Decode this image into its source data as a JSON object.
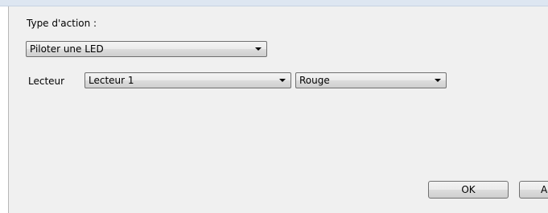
{
  "action_type": {
    "label": "Type d'action :",
    "selected": "Piloter une LED"
  },
  "reader": {
    "label": "Lecteur",
    "selected": "Lecteur 1"
  },
  "color": {
    "selected": "Rouge"
  },
  "buttons": {
    "ok": "OK",
    "cancel_partial": "Ar"
  },
  "icons": {
    "dropdown": "chevron-down-icon"
  }
}
